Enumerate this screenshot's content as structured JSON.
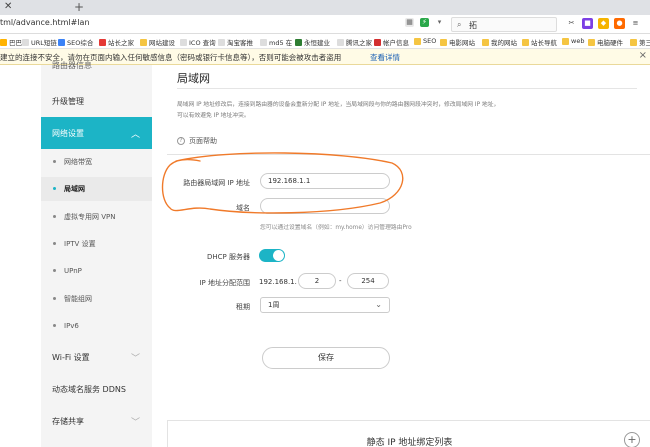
{
  "browser": {
    "close_glyph": "✕",
    "new_tab_glyph": "+",
    "url": "tml/advance.html#lan",
    "search_query": "拓",
    "bookmarks": [
      "巴巴",
      "URL短链",
      "SEO综合",
      "站长之家",
      "网站建设",
      "ICO 查询",
      "淘宝客推",
      "md5 在",
      "永恒建业",
      "腾讯之家",
      "帐户信息",
      "SEO",
      "电影网站",
      "我的网站",
      "站长导航",
      "web",
      "电脑硬件",
      "第三"
    ]
  },
  "warning": {
    "text": "建立的连接不安全，请勿在页面内输入任何敏感信息（密码或银行卡信息等），否则可能会被攻击者盗用",
    "link": "查看详情",
    "close_glyph": "×"
  },
  "sidebar": {
    "top_partial": "路由器信息",
    "upgrade": "升级管理",
    "network": "网络设置",
    "subs": [
      "网络带宽",
      "局域网",
      "虚拟专用网 VPN",
      "IPTV 设置",
      "UPnP",
      "智能组网",
      "IPv6"
    ],
    "wifi": "Wi-Fi 设置",
    "ddns": "动态域名服务 DDNS",
    "storage": "存储共享"
  },
  "main": {
    "title": "局域网",
    "desc_line1": "局域网 IP 地址修改后，连接到路由器的设备会重新分配 IP 地址，当局域网段与你的路由器网段冲突时，修改局域网 IP 地址，",
    "desc_line2": "可以有效避免 IP 地址冲突。",
    "help": "页面帮助",
    "ip_label": "路由器局域网 IP 地址",
    "ip_value": "192.168.1.1",
    "domain_label": "域名",
    "domain_value": "",
    "domain_hint": "您可以通过设置域名（例如：my.home）访问管理路由Pro",
    "dhcp_label": "DHCP 服务器",
    "range_label": "IP 地址分配范围",
    "range_prefix": "192.168.1.",
    "range_start": "2",
    "range_dash": "-",
    "range_end": "254",
    "lease_label": "租期",
    "lease_value": "1周",
    "save": "保存",
    "static_ip_title": "静态 IP 地址绑定列表",
    "add_glyph": "+"
  }
}
